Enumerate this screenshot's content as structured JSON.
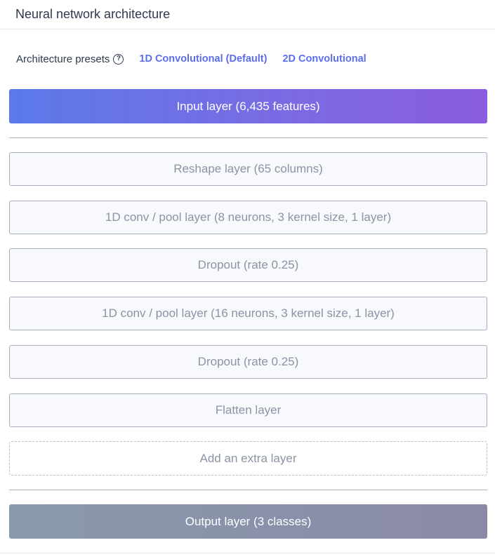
{
  "header": {
    "title": "Neural network architecture"
  },
  "presets": {
    "label": "Architecture presets",
    "help_icon": "question-circle-icon",
    "options": [
      "1D Convolutional (Default)",
      "2D Convolutional"
    ]
  },
  "layers": {
    "input": "Input layer (6,435 features)",
    "hidden": [
      "Reshape layer (65 columns)",
      "1D conv / pool layer (8 neurons, 3 kernel size, 1 layer)",
      "Dropout (rate 0.25)",
      "1D conv / pool layer (16 neurons, 3 kernel size, 1 layer)",
      "Dropout (rate 0.25)",
      "Flatten layer"
    ],
    "add_extra": "Add an extra layer",
    "output": "Output layer (3 classes)"
  },
  "colors": {
    "accent_link": "#5b6ee8",
    "input_gradient_start": "#5b79e8",
    "input_gradient_end": "#8a5ce0",
    "output_gradient_start": "#8a9aab",
    "output_gradient_end": "#8a89a8"
  }
}
